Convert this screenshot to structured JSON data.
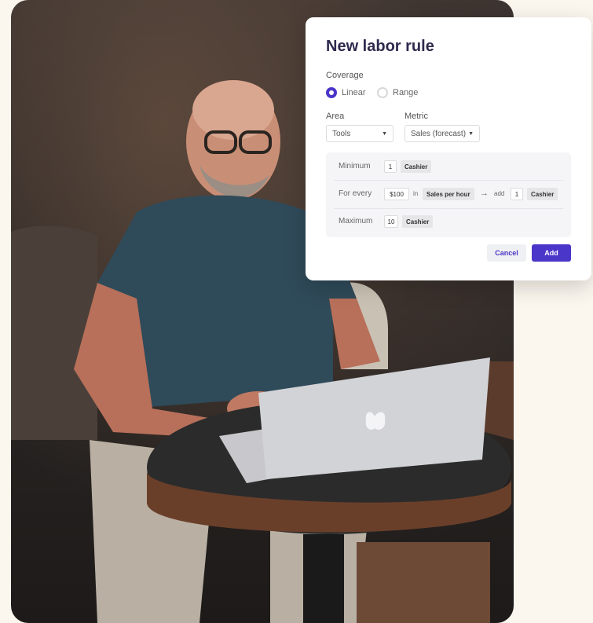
{
  "dialog": {
    "title": "New labor rule",
    "coverage": {
      "label": "Coverage",
      "options": [
        "Linear",
        "Range"
      ],
      "selected": "Linear"
    },
    "area": {
      "label": "Area",
      "value": "Tools"
    },
    "metric": {
      "label": "Metric",
      "value": "Sales (forecast)"
    },
    "rules": {
      "minimum": {
        "label": "Minimum",
        "value": "1",
        "role": "Cashier"
      },
      "for_every": {
        "label": "For every",
        "amount": "$100",
        "in_text": "in",
        "unit": "Sales per hour",
        "arrow": "→",
        "add_text": "add",
        "add_value": "1",
        "role": "Cashier"
      },
      "maximum": {
        "label": "Maximum",
        "value": "10",
        "role": "Cashier"
      }
    },
    "buttons": {
      "cancel": "Cancel",
      "add": "Add"
    }
  },
  "colors": {
    "accent": "#4a36c9",
    "title": "#2e2a4d",
    "page_bg": "#fbf6ee"
  }
}
